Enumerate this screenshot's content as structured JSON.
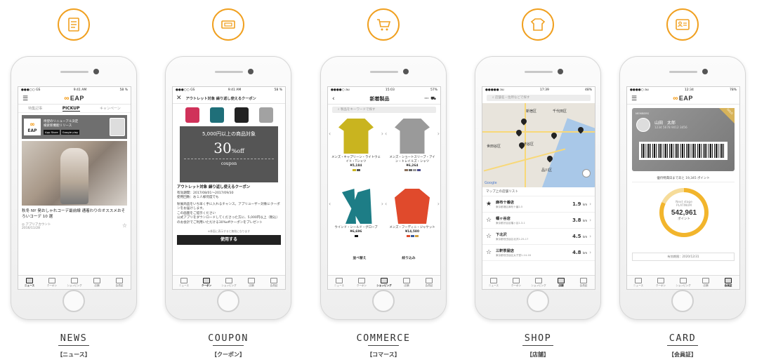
{
  "brand_color": "#f39200",
  "columns": [
    {
      "key": "news",
      "icon": "news-document-icon",
      "caption": "NEWS",
      "subcaption": "【ニュース】"
    },
    {
      "key": "coupon",
      "icon": "coupon-ticket-icon",
      "caption": "COUPON",
      "subcaption": "【クーポン】"
    },
    {
      "key": "commerce",
      "icon": "shopping-cart-icon",
      "caption": "COMMERCE",
      "subcaption": "【コマース】"
    },
    {
      "key": "shop",
      "icon": "shop-shirt-icon",
      "caption": "SHOP",
      "subcaption": "【店舗】"
    },
    {
      "key": "card",
      "icon": "member-card-icon",
      "caption": "CARD",
      "subcaption": "【会員証】"
    }
  ],
  "logo": "EAP",
  "tabs": [
    "ニュース",
    "クーポン",
    "ショッピング",
    "店舗",
    "会員証"
  ],
  "news": {
    "time": "9:41 AM",
    "battery": "58 %",
    "carrier": "●●●○○ GS",
    "subtabs": [
      "特集記事",
      "PICKUP",
      "キャンペーン"
    ],
    "banner_title": "待望のリニューアル決定",
    "banner_sub": "検索新機能リリース",
    "app_store": "App Store",
    "google_play": "Google play",
    "article_title": "秋冬 NY 発おしゃれコーデ最前線 通着わりのオススメおそろいコーデ 10 選",
    "author": "アプリアカウント",
    "date": "2016/11/28"
  },
  "coupon": {
    "time": "9:41 AM",
    "battery": "58 %",
    "header": "アウトレット対象 繰り返し使えるクーポン",
    "line1": "5,000円以上の商品対象",
    "percent": "30",
    "off": "%off",
    "coupon_word": "coupon",
    "title": "アウトレット対象 繰り返し使えるクーポン",
    "period": "有効期間：2017/08/01〜2017/09/30",
    "uses": "使用回数：お１人様何度でも",
    "body1": "秋展商品をいち早く手に入れるチャンス。アプリユーザー対象にクーポンをお届けします。",
    "body2": "この画面をご提示ください",
    "body3": "公式アプリをダウンロードしてくださった方に、5,000円以上（税込）のお会計でご利用いただける30%offクーポンをプレゼント",
    "note": "※券面に表示すると無効になります",
    "use_button": "使用する"
  },
  "commerce": {
    "time": "15:03",
    "carrier": "●●●●○ au",
    "battery": "57%",
    "title": "新着製品",
    "search_placeholder": "製品をキーワードで探す",
    "items": [
      {
        "name": "メンズ・キャプリーン・ライトウェイト・Tシャツ",
        "price": "¥5,184",
        "color": "#c9b41f"
      },
      {
        "name": "メンズ・ショートスリーブ・アイン・トレイルズ・シャツ",
        "price": "¥6,264",
        "color": "#9a9a9a"
      },
      {
        "name": "ウインド・シールド・グローブ",
        "price": "¥6,696",
        "color": "#1d7d86"
      },
      {
        "name": "メンズ・フーディニ・ジャケット",
        "price": "¥14,580",
        "color": "#e04a2c"
      }
    ],
    "sort_label": "並べ替え",
    "filter_label": "絞り込み"
  },
  "shop": {
    "time": "17:39",
    "carrier": "●●●●● au",
    "battery": "48%",
    "search_placeholder": "店舗名・住所などで探す",
    "map_labels": [
      "新宿区",
      "千代田区",
      "世田谷区",
      "渋谷区",
      "品川区"
    ],
    "list_title": "マップ上の店舗リスト",
    "shops": [
      {
        "name": "麻布十番店",
        "address": "東京都港区麻布十番2-5",
        "distance": "1.9",
        "unit": "km",
        "fav": "★"
      },
      {
        "name": "幡ヶ谷店",
        "address": "東京都渋谷区幡ヶ谷1-3-1",
        "distance": "3.8",
        "unit": "km",
        "fav": "☆"
      },
      {
        "name": "下北沢",
        "address": "東京都世田谷区北沢2-25-17",
        "distance": "4.5",
        "unit": "km",
        "fav": "☆"
      },
      {
        "name": "三軒茶屋店",
        "address": "東京都世田谷区太子堂1-14-16",
        "distance": "4.8",
        "unit": "km",
        "fav": "☆"
      }
    ],
    "google": "Google"
  },
  "card": {
    "time": "12:34",
    "carrier": "●●●●○ au",
    "battery": "78%",
    "members_label": "MEMBERS",
    "gold_label": "GOLD",
    "member_name": "山田　太郎",
    "member_number": "1234 5678 9012 3456",
    "points_note": "優待特典日まであと 19,345 ポイント",
    "next_stage": "Next stage",
    "stage": "PLATINUM",
    "points": "542,961",
    "points_unit": "ポイント",
    "expiry": "有効期限：2020/12/31"
  }
}
